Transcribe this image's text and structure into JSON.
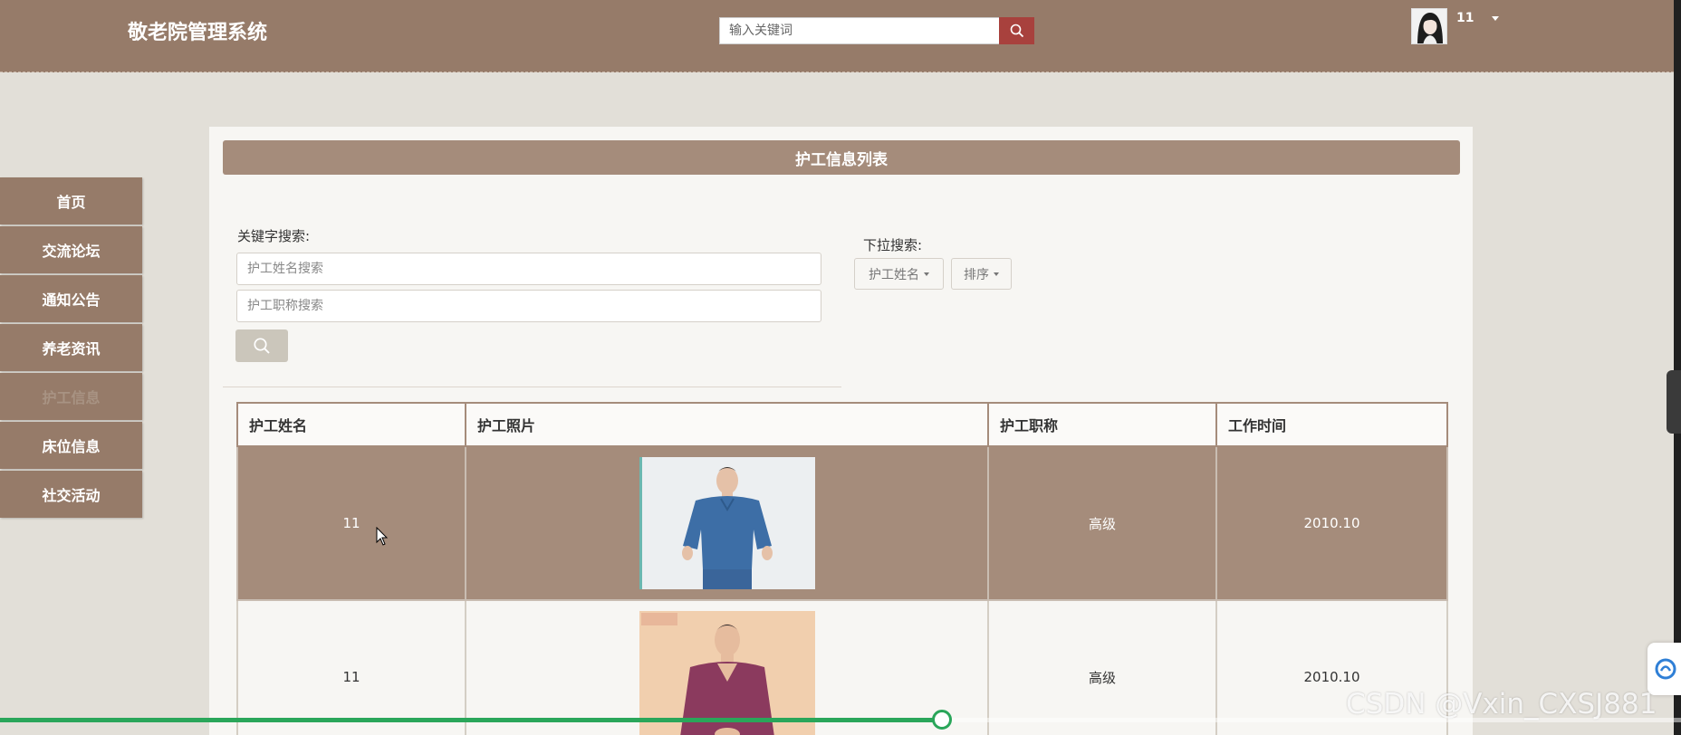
{
  "header": {
    "title": "敬老院管理系统",
    "search_placeholder": "输入关键词",
    "user_name": "11"
  },
  "sidebar": {
    "items": [
      {
        "label": "首页"
      },
      {
        "label": "交流论坛"
      },
      {
        "label": "通知公告"
      },
      {
        "label": "养老资讯"
      },
      {
        "label": "护工信息",
        "active": true
      },
      {
        "label": "床位信息"
      },
      {
        "label": "社交活动"
      }
    ]
  },
  "panel": {
    "title": "护工信息列表",
    "keyword_label": "关键字搜索:",
    "name_placeholder": "护工姓名搜索",
    "title_placeholder": "护工职称搜索",
    "dropdown_label": "下拉搜索:",
    "dropdown_name": "护工姓名",
    "dropdown_sort": "排序"
  },
  "table": {
    "headers": [
      "护工姓名",
      "护工照片",
      "护工职称",
      "工作时间"
    ],
    "rows": [
      {
        "name": "11",
        "photo": "blue-uniform-caregiver-photo",
        "title": "高级",
        "time": "2010.10",
        "highlighted": true
      },
      {
        "name": "11",
        "photo": "purple-uniform-caregiver-photo",
        "title": "高级",
        "time": "2010.10",
        "highlighted": false
      }
    ]
  },
  "player": {
    "progress": 0.56
  },
  "watermark": "CSDN @Vxin_CXSJ881",
  "colors": {
    "header_bg": "#967b69",
    "accent": "#a58c7b",
    "search_button": "#a8413d",
    "progress": "#2aa65a"
  }
}
